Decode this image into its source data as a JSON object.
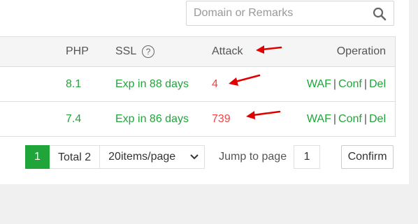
{
  "search": {
    "placeholder": "Domain or Remarks"
  },
  "table": {
    "headers": {
      "php": "PHP",
      "ssl": "SSL",
      "ssl_help": "?",
      "attack": "Attack",
      "operation": "Operation"
    },
    "rows": [
      {
        "php": "8.1",
        "ssl": "Exp in 88 days",
        "attack": "4",
        "ops": [
          "WAF",
          "Conf",
          "Del"
        ]
      },
      {
        "php": "7.4",
        "ssl": "Exp in 86 days",
        "attack": "739",
        "ops": [
          "WAF",
          "Conf",
          "Del"
        ]
      }
    ],
    "separator": "|"
  },
  "pager": {
    "current_page": "1",
    "total": "Total 2",
    "per_page": "20items/page",
    "jump_label": "Jump to page",
    "jump_value": "1",
    "confirm": "Confirm"
  },
  "colors": {
    "accent_green": "#20a53a",
    "attack_red": "#ef4545",
    "annotation_arrow": "#e00000"
  },
  "icons": {
    "search": "search-icon",
    "help": "question-circle-icon",
    "dropdown": "chevron-down-icon",
    "annotation": "red-arrow-icon"
  }
}
